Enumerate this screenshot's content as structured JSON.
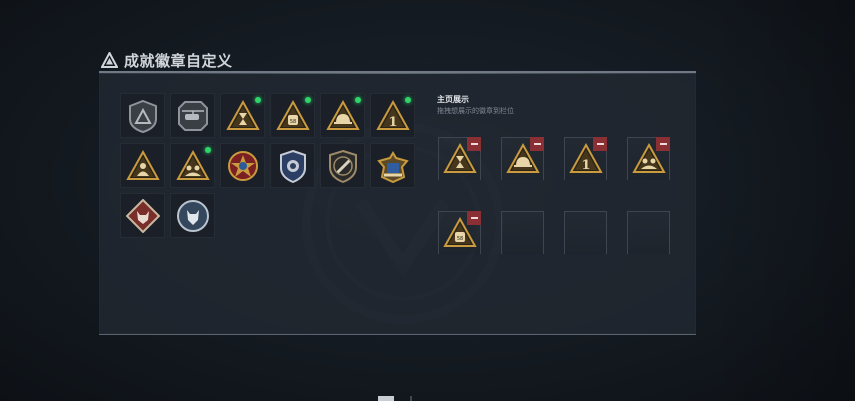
{
  "header": {
    "title": "成就徽章自定义",
    "icon": "warning-triangle-icon"
  },
  "badges": [
    {
      "icon": "gray-shield-triangle-badge-icon",
      "new": false
    },
    {
      "icon": "gray-helicopter-badge-icon",
      "new": false
    },
    {
      "icon": "gold-hourglass-badge-icon",
      "new": true
    },
    {
      "icon": "gold-dogtag-badge-icon",
      "new": true
    },
    {
      "icon": "gold-helmet-badge-icon",
      "new": true
    },
    {
      "icon": "gold-rank-one-badge-icon",
      "new": true
    },
    {
      "icon": "gold-soldiers-badge-icon",
      "new": false
    },
    {
      "icon": "gold-squad-badge-icon",
      "new": true
    },
    {
      "icon": "star-medal-badge-icon",
      "new": false
    },
    {
      "icon": "police-shield-badge-icon",
      "new": false
    },
    {
      "icon": "bronze-knife-shield-badge-icon",
      "new": false
    },
    {
      "icon": "winged-crest-badge-icon",
      "new": false
    },
    {
      "icon": "wolf-diamond-badge-icon",
      "new": false
    },
    {
      "icon": "wolf-round-badge-icon",
      "new": false
    }
  ],
  "showcase": {
    "title": "主页展示",
    "subtitle": "拖拽想展示的徽章到栏位",
    "slots": [
      {
        "icon": "gold-hourglass-badge-icon",
        "filled": true
      },
      {
        "icon": "gold-helmet-badge-icon",
        "filled": true
      },
      {
        "icon": "gold-rank-one-badge-icon",
        "filled": true
      },
      {
        "icon": "gold-squad-badge-icon",
        "filled": true
      },
      {
        "icon": "gold-dogtag-badge-icon",
        "filled": true
      },
      {
        "icon": "",
        "filled": false
      },
      {
        "icon": "",
        "filled": false
      },
      {
        "icon": "",
        "filled": false
      }
    ]
  },
  "colors": {
    "accent_new": "#2fd46a",
    "remove": "#8a2f34",
    "gold": "#c99a3e",
    "panel": "#222932"
  }
}
